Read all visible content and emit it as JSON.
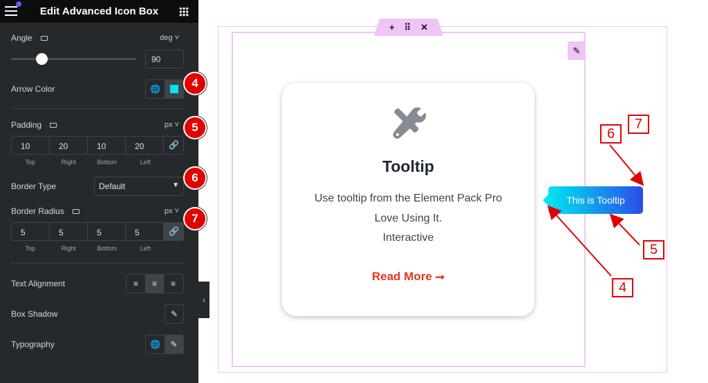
{
  "panel": {
    "title": "Edit Advanced Icon Box",
    "angle": {
      "label": "Angle",
      "unit": "deg",
      "value": "90",
      "slider_percent": 25
    },
    "arrow_color": {
      "label": "Arrow Color",
      "color": "#00e5f0"
    },
    "padding": {
      "label": "Padding",
      "unit": "px",
      "values": [
        "10",
        "20",
        "10",
        "20"
      ],
      "sides": [
        "Top",
        "Right",
        "Bottom",
        "Left"
      ]
    },
    "border_type": {
      "label": "Border Type",
      "value": "Default"
    },
    "border_radius": {
      "label": "Border Radius",
      "unit": "px",
      "values": [
        "5",
        "5",
        "5",
        "5"
      ],
      "sides": [
        "Top",
        "Right",
        "Bottom",
        "Left"
      ]
    },
    "text_alignment": {
      "label": "Text Alignment",
      "selected": "center"
    },
    "box_shadow": {
      "label": "Box Shadow"
    },
    "typography": {
      "label": "Typography"
    }
  },
  "badges": [
    "4",
    "5",
    "6",
    "7"
  ],
  "card": {
    "title": "Tooltip",
    "lines": [
      "Use tooltip from the Element Pack Pro",
      "Love Using It.",
      "Interactive"
    ],
    "link": "Read More",
    "link_color": "#e8341c",
    "icon": "tools-icon"
  },
  "tooltip": {
    "text": "This is Tooltip",
    "gradient": [
      "#00e5f0",
      "#2a4de8"
    ]
  },
  "callouts": [
    "6",
    "7",
    "5",
    "4"
  ]
}
